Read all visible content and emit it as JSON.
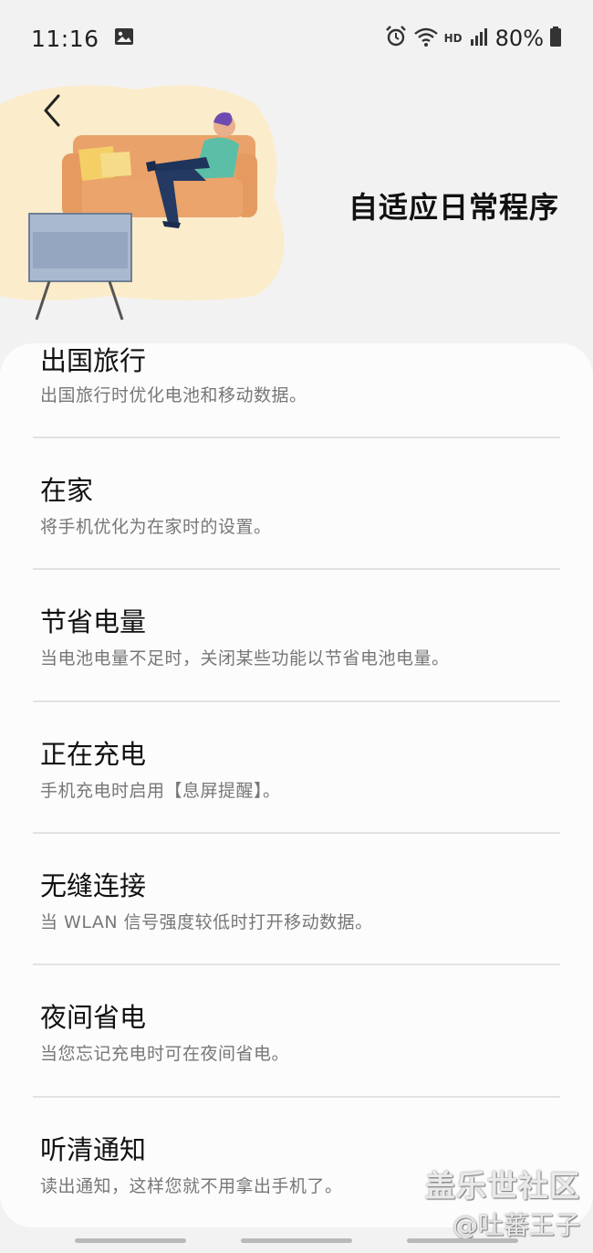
{
  "status": {
    "time": "11:16",
    "network_label": "HD",
    "battery": "80%"
  },
  "header": {
    "title": "自适应日常程序"
  },
  "items": [
    {
      "title": "出国旅行",
      "desc": "出国旅行时优化电池和移动数据。"
    },
    {
      "title": "在家",
      "desc": "将手机优化为在家时的设置。"
    },
    {
      "title": "节省电量",
      "desc": "当电池电量不足时，关闭某些功能以节省电池电量。"
    },
    {
      "title": "正在充电",
      "desc": "手机充电时启用【息屏提醒】。"
    },
    {
      "title": "无缝连接",
      "desc": "当 WLAN 信号强度较低时打开移动数据。"
    },
    {
      "title": "夜间省电",
      "desc": "当您忘记充电时可在夜间省电。"
    },
    {
      "title": "听清通知",
      "desc": "读出通知，这样您就不用拿出手机了。"
    }
  ],
  "watermark": {
    "line1": "盖乐世社区",
    "line2": "@吐蕃王子"
  },
  "colors": {
    "background": "#f2f2f2",
    "card": "#fcfcfc",
    "illustration_blob": "#fbeccb",
    "sofa": "#e9a36a",
    "tv": "#a9b9cf"
  }
}
